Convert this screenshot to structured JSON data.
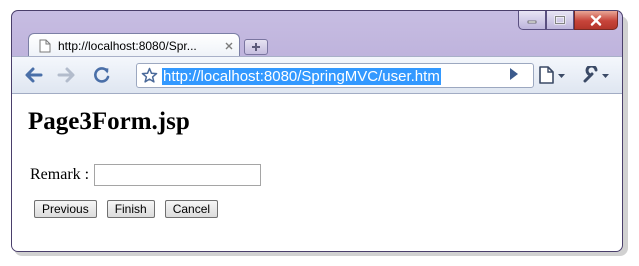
{
  "browser": {
    "tab": {
      "title": "http://localhost:8080/Spr..."
    },
    "address_bar": {
      "url": "http://localhost:8080/SpringMVC/user.htm"
    },
    "window_controls": [
      "minimize-icon",
      "maximize-icon",
      "close-icon"
    ],
    "toolbar_icons": [
      "back-arrow-icon",
      "forward-arrow-icon",
      "reload-icon",
      "star-icon",
      "go-arrow-icon",
      "page-menu-icon",
      "wrench-icon"
    ]
  },
  "page": {
    "heading": "Page3Form.jsp",
    "form": {
      "remark_label": "Remark :",
      "remark_value": "",
      "buttons": {
        "previous": "Previous",
        "finish": "Finish",
        "cancel": "Cancel"
      }
    }
  },
  "colors": {
    "frame": "#b3a6d5",
    "url_highlight": "#3399ff",
    "close_button": "#c7443a"
  }
}
